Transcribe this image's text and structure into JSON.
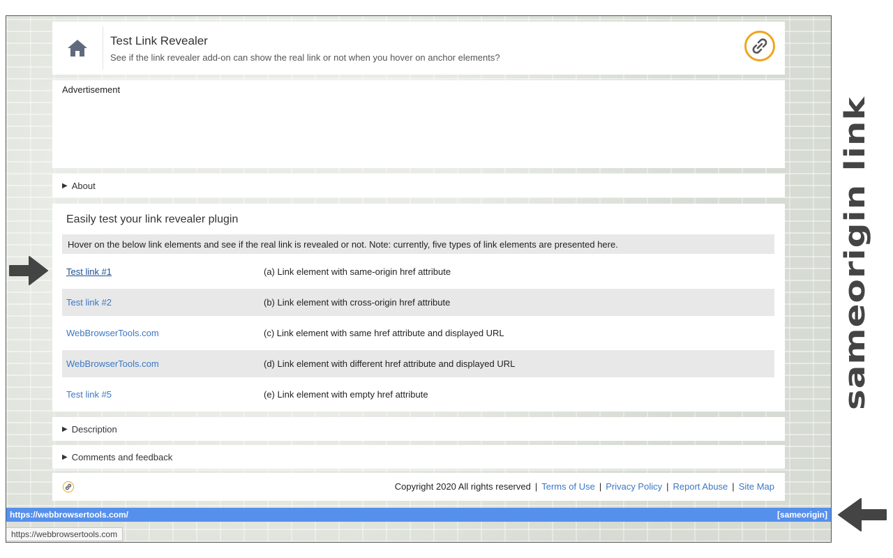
{
  "header": {
    "title": "Test Link Revealer",
    "subtitle": "See if the link revealer add-on can show the real link or not when you hover on anchor elements?"
  },
  "ad": {
    "label": "Advertisement"
  },
  "sections": {
    "about": "About",
    "description": "Description",
    "comments": "Comments and feedback"
  },
  "main": {
    "title": "Easily test your link revealer plugin",
    "note": "Hover on the below link elements and see if the real link is revealed or not. Note: currently, five types of link elements are presented here.",
    "rows": [
      {
        "link": "Test link #1",
        "desc": "(a) Link element with same-origin href attribute"
      },
      {
        "link": "Test link #2",
        "desc": "(b) Link element with cross-origin href attribute"
      },
      {
        "link": "WebBrowserTools.com",
        "desc": "(c) Link element with same href attribute and displayed URL"
      },
      {
        "link": "WebBrowserTools.com",
        "desc": "(d) Link element with different href attribute and displayed URL"
      },
      {
        "link": "Test link #5",
        "desc": "(e) Link element with empty href attribute"
      }
    ]
  },
  "footer": {
    "copyright": "Copyright 2020 All rights reserved",
    "links": [
      "Terms of Use",
      "Privacy Policy",
      "Report Abuse",
      "Site Map"
    ]
  },
  "statusbar": {
    "url": "https://webbrowsertools.com/",
    "tag": "[sameorigin]"
  },
  "tooltip": "https://webbrowsertools.com",
  "annotation": "sameorigin link",
  "colors": {
    "accent": "#f0a41c",
    "link": "#3b78c4",
    "statusbar": "#5590ec"
  },
  "icons": {
    "home": "home-icon",
    "logo": "link-chain-icon",
    "arrows": "arrow-icon"
  }
}
